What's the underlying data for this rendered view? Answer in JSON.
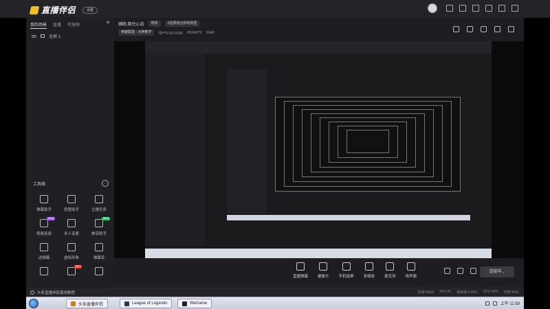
{
  "app": {
    "name": "直播伴侣",
    "tag": "设置"
  },
  "sidebar": {
    "tabs": [
      {
        "label": "我的场景",
        "active": true
      },
      {
        "label": "直播"
      },
      {
        "label": "可放映"
      }
    ],
    "add_icon": "plus-icon",
    "scene": {
      "label": "全屏 1"
    },
    "tools_heading": "工具箱",
    "tools": [
      {
        "label": "弹幕助手",
        "icon": "chat-icon"
      },
      {
        "label": "房管助手",
        "icon": "user-icon"
      },
      {
        "label": "主播任务",
        "icon": "bag-icon"
      },
      {
        "label": "视频连接",
        "icon": "link-icon",
        "badge": "NEW",
        "badge_color": "#a855f7"
      },
      {
        "label": "多人连麦",
        "icon": "download-icon"
      },
      {
        "label": "推流助手",
        "icon": "gift-icon",
        "badge": "NEW",
        "badge_color": "#22c55e"
      },
      {
        "label": "送弹幕",
        "icon": "image-icon"
      },
      {
        "label": "虚拟形象",
        "icon": "download-icon"
      },
      {
        "label": "弹幕库",
        "icon": "calendar-icon"
      },
      {
        "label": "",
        "icon": "grid-icon"
      },
      {
        "label": "",
        "icon": "image-icon",
        "badge": "HOT",
        "badge_color": "#ef4444"
      },
      {
        "label": "",
        "icon": "download-icon"
      }
    ]
  },
  "header": {
    "room_title": "辅助,稳住心态",
    "edit_chip": "修改",
    "tag_chip": "#选择适合你的标签",
    "category": "英雄联盟 · 大神教学",
    "user_id": "用户51872586",
    "room_id": "9534679",
    "fans": "3640"
  },
  "controls": [
    {
      "label": "直播弹幕",
      "icon": "chat-icon"
    },
    {
      "label": "摄像头",
      "icon": "camera-icon"
    },
    {
      "label": "手机投屏",
      "icon": "phone-icon"
    },
    {
      "label": "多媒体",
      "icon": "play-icon"
    },
    {
      "label": "麦克风",
      "icon": "mic-icon"
    },
    {
      "label": "扬声器",
      "icon": "speaker-icon"
    }
  ],
  "start_live_label": "连接中...",
  "status": {
    "tip": "头条直播伴侣使用教程",
    "stats": [
      "码率:0kb/s",
      "FPS:25",
      "丢帧率:0.00%",
      "CPU:15%",
      "内存:44%"
    ]
  },
  "taskbar": {
    "items": [
      {
        "label": "头条直播伴侣",
        "color": "#d97706"
      },
      {
        "label": "League of Legends",
        "color": "#1e3a5f"
      },
      {
        "label": "WeGame",
        "color": "#222222"
      }
    ],
    "time": "上午 11:59"
  }
}
